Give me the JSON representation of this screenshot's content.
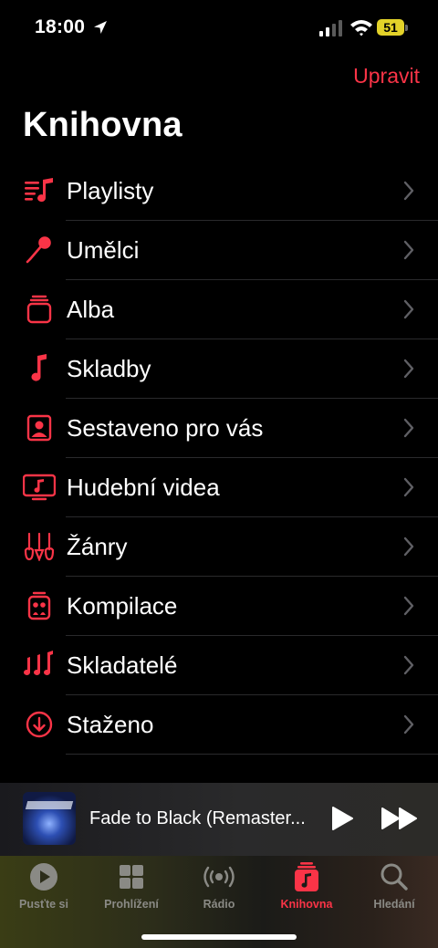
{
  "status": {
    "time": "18:00",
    "battery": "51"
  },
  "header": {
    "edit_label": "Upravit",
    "title": "Knihovna"
  },
  "library_items": [
    {
      "label": "Playlisty",
      "icon": "playlist-icon"
    },
    {
      "label": "Umělci",
      "icon": "microphone-icon"
    },
    {
      "label": "Alba",
      "icon": "album-stack-icon"
    },
    {
      "label": "Skladby",
      "icon": "music-note-icon"
    },
    {
      "label": "Sestaveno pro vás",
      "icon": "person-square-icon"
    },
    {
      "label": "Hudební videa",
      "icon": "tv-music-icon"
    },
    {
      "label": "Žánry",
      "icon": "guitars-icon"
    },
    {
      "label": "Kompilace",
      "icon": "compilation-icon"
    },
    {
      "label": "Skladatelé",
      "icon": "notes-icon"
    },
    {
      "label": "Staženo",
      "icon": "download-circle-icon"
    }
  ],
  "now_playing": {
    "title": "Fade to Black (Remaster..."
  },
  "tabs": [
    {
      "label": "Pusťte si",
      "icon": "play-circle-icon"
    },
    {
      "label": "Prohlížení",
      "icon": "grid-icon"
    },
    {
      "label": "Rádio",
      "icon": "radio-icon"
    },
    {
      "label": "Knihovna",
      "icon": "library-icon",
      "active": true
    },
    {
      "label": "Hledání",
      "icon": "search-icon"
    }
  ],
  "colors": {
    "accent": "#fa3447",
    "background": "#000000",
    "separator": "#2a2a2c",
    "battery": "#e3d229"
  }
}
